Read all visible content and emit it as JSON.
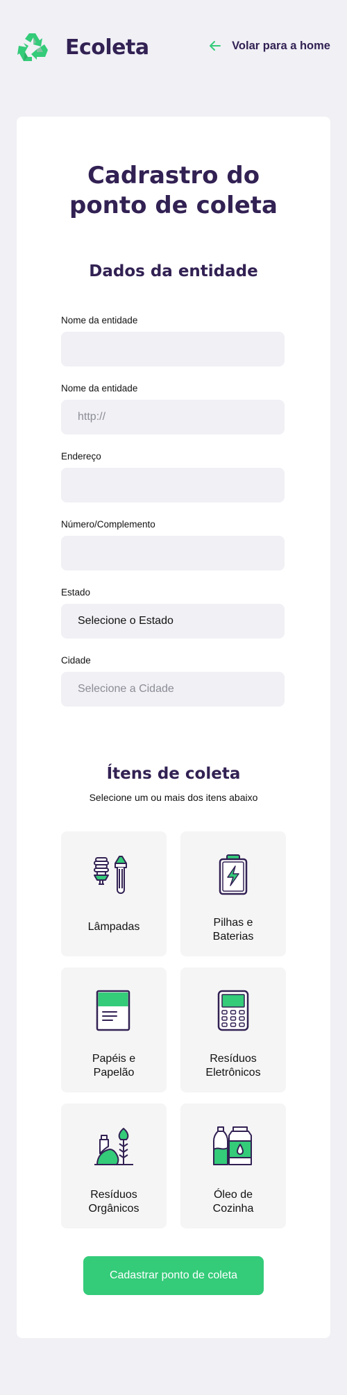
{
  "header": {
    "logo_text": "Ecoleta",
    "logo_icon": "recycle-icon",
    "back_label": "Volar para a home",
    "back_icon": "arrow-left-icon"
  },
  "form": {
    "title_line1": "Cadrastro do",
    "title_line2": "ponto de coleta",
    "entity_section": "Dados da entidade",
    "fields": [
      {
        "label": "Nome da entidade",
        "value": "",
        "placeholder": ""
      },
      {
        "label": "Nome da entidade",
        "value": "",
        "placeholder": "http://"
      },
      {
        "label": "Endereço",
        "value": "",
        "placeholder": ""
      },
      {
        "label": "Número/Complemento",
        "value": "",
        "placeholder": ""
      },
      {
        "label": "Estado",
        "value": "Selecione o Estado",
        "placeholder": ""
      },
      {
        "label": "Cidade",
        "value": "",
        "placeholder": "Selecione a Cidade"
      }
    ],
    "items_section": "Ítens de coleta",
    "items_subtitle": "Selecione um ou mais dos itens abaixo",
    "items": [
      {
        "label": "Lâmpadas",
        "icon": "lamps-icon"
      },
      {
        "label": "Pilhas e Baterias",
        "icon": "battery-icon"
      },
      {
        "label": "Papéis e Papelão",
        "icon": "paper-icon"
      },
      {
        "label": "Resíduos Eletrônicos",
        "icon": "electronics-icon"
      },
      {
        "label": "Resíduos Orgânicos",
        "icon": "organic-icon"
      },
      {
        "label": "Óleo de Cozinha",
        "icon": "oil-icon"
      }
    ],
    "submit_label": "Cadastrar ponto de coleta"
  },
  "colors": {
    "background": "#f0f0f5",
    "primary_text": "#322153",
    "accent": "#34cb79"
  }
}
